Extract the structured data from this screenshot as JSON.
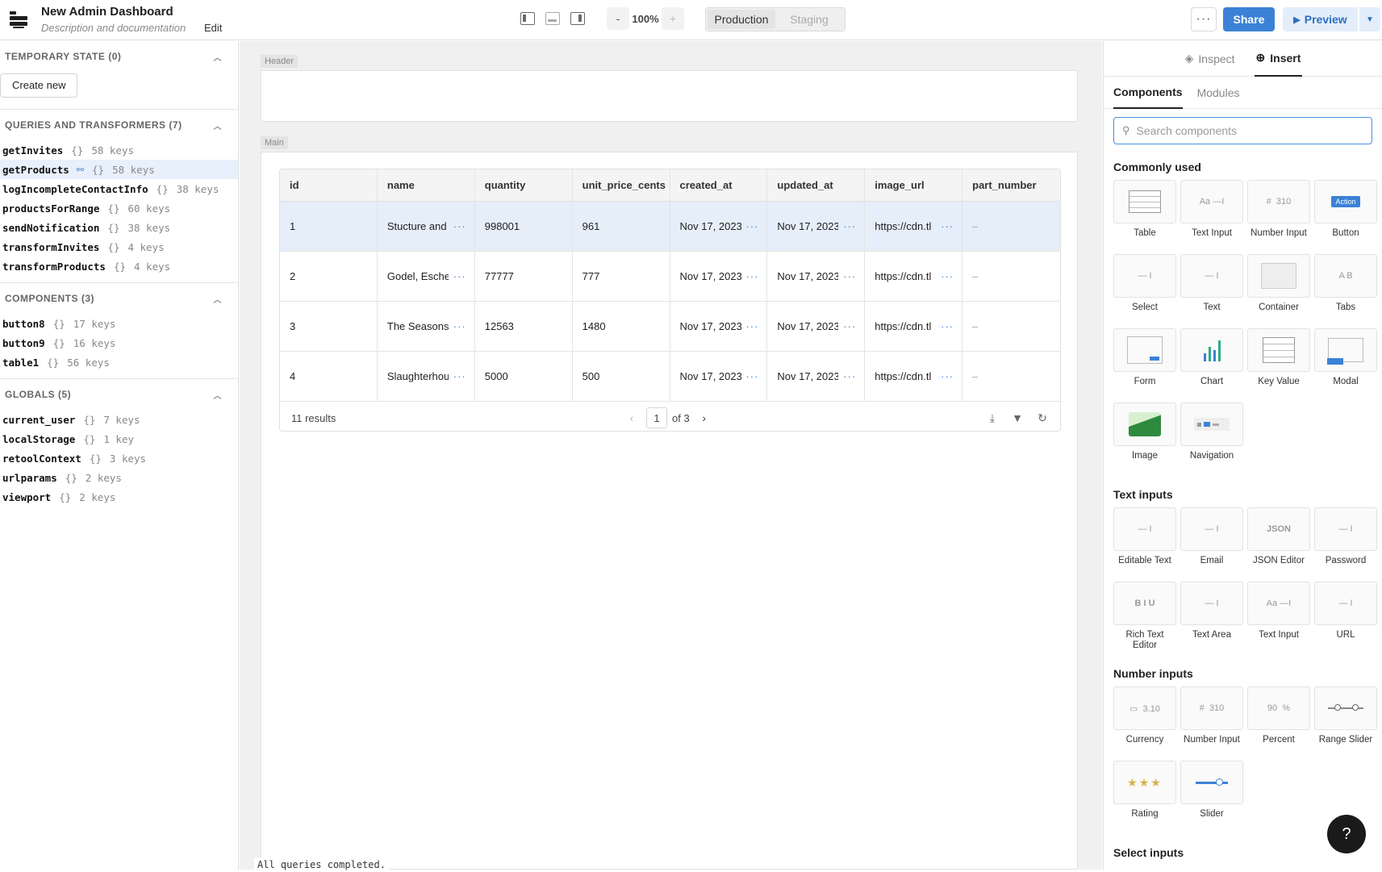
{
  "app": {
    "title": "New Admin Dashboard",
    "description": "Description and documentation",
    "edit_label": "Edit"
  },
  "toolbar": {
    "zoom_out": "-",
    "zoom_value": "100%",
    "zoom_in": "+",
    "env_options": [
      "Production",
      "Staging"
    ],
    "env_active": "Production",
    "more_label": "···",
    "share_label": "Share",
    "preview_label": "Preview"
  },
  "left_panel": {
    "temporary_state": {
      "title": "TEMPORARY STATE (0)",
      "create_label": "Create new"
    },
    "queries": {
      "title": "QUERIES AND TRANSFORMERS (7)",
      "items": [
        {
          "name": "getInvites",
          "keys": "58 keys"
        },
        {
          "name": "getProducts",
          "keys": "58 keys"
        },
        {
          "name": "logIncompleteContactInfo",
          "keys": "38 keys"
        },
        {
          "name": "productsForRange",
          "keys": "60 keys"
        },
        {
          "name": "sendNotification",
          "keys": "38 keys"
        },
        {
          "name": "transformInvites",
          "keys": "4 keys"
        },
        {
          "name": "transformProducts",
          "keys": "4 keys"
        }
      ]
    },
    "components": {
      "title": "COMPONENTS (3)",
      "items": [
        {
          "name": "button8",
          "keys": "17 keys"
        },
        {
          "name": "button9",
          "keys": "16 keys"
        },
        {
          "name": "table1",
          "keys": "56 keys"
        }
      ]
    },
    "globals": {
      "title": "GLOBALS (5)",
      "items": [
        {
          "name": "current_user",
          "keys": "7 keys"
        },
        {
          "name": "localStorage",
          "keys": "1 key"
        },
        {
          "name": "retoolContext",
          "keys": "3 keys"
        },
        {
          "name": "urlparams",
          "keys": "2 keys"
        },
        {
          "name": "viewport",
          "keys": "2 keys"
        }
      ]
    },
    "braces": "{}"
  },
  "canvas": {
    "header_label": "Header",
    "main_label": "Main",
    "console": "All queries completed.",
    "table": {
      "columns": [
        "id",
        "name",
        "quantity",
        "unit_price_cents",
        "created_at",
        "updated_at",
        "image_url",
        "part_number"
      ],
      "rows": [
        [
          "1",
          "Stucture and",
          "998001",
          "961",
          "Nov 17, 2023",
          "Nov 17, 2023",
          "https://cdn.tl",
          "–"
        ],
        [
          "2",
          "Godel, Escher",
          "77777",
          "777",
          "Nov 17, 2023",
          "Nov 17, 2023",
          "https://cdn.tl",
          "–"
        ],
        [
          "3",
          "The Seasons",
          "12563",
          "1480",
          "Nov 17, 2023",
          "Nov 17, 2023",
          "https://cdn.tl",
          "–"
        ],
        [
          "4",
          "Slaughterhouse",
          "5000",
          "500",
          "Nov 17, 2023",
          "Nov 17, 2023",
          "https://cdn.tl",
          "–"
        ]
      ],
      "results": "11 results",
      "page": "1",
      "page_of": "of 3"
    }
  },
  "right_panel": {
    "tabs": [
      "Inspect",
      "Insert"
    ],
    "active_tab": "Insert",
    "subtabs": [
      "Components",
      "Modules"
    ],
    "search_placeholder": "Search components",
    "sections": [
      {
        "title": "Commonly used",
        "items": [
          "Table",
          "Text Input",
          "Number Input",
          "Button",
          "Select",
          "Text",
          "Container",
          "Tabs",
          "Form",
          "Chart",
          "Key Value",
          "Modal",
          "Image",
          "Navigation"
        ]
      },
      {
        "title": "Text inputs",
        "items": [
          "Editable Text",
          "Email",
          "JSON Editor",
          "Password",
          "Rich Text Editor",
          "Text Area",
          "Text Input",
          "URL"
        ]
      },
      {
        "title": "Number inputs",
        "items": [
          "Currency",
          "Number Input",
          "Percent",
          "Range Slider",
          "Rating",
          "Slider"
        ]
      },
      {
        "title": "Select inputs",
        "items": []
      }
    ],
    "tile_glyphs": {
      "number": "310",
      "action": "Action",
      "json": "JSON",
      "currency": "3.10",
      "percent": "90",
      "rating": "★★★",
      "tabs_ab": "A B",
      "rte": "B I U"
    },
    "accent": "#3b82d6"
  },
  "help_label": "?"
}
